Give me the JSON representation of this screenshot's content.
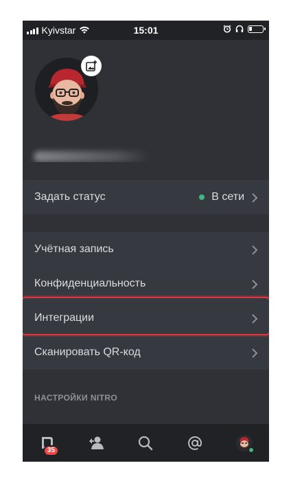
{
  "status_bar": {
    "carrier": "Kyivstar",
    "time": "15:01"
  },
  "profile": {
    "username_blurred": true
  },
  "rows": {
    "set_status": {
      "label": "Задать статус",
      "value": "В сети",
      "dot_color": "#43b581"
    },
    "account": {
      "label": "Учётная запись"
    },
    "privacy": {
      "label": "Конфиденциальность"
    },
    "integrations": {
      "label": "Интеграции",
      "highlighted": true
    },
    "scan_qr": {
      "label": "Сканировать QR-код"
    }
  },
  "sections": {
    "nitro_header": "НАСТРОЙКИ NITRO"
  },
  "tabbar": {
    "tabs": [
      "servers-tab",
      "friends-tab",
      "search-tab",
      "mentions-tab",
      "profile-tab"
    ],
    "notification_badge": "35"
  },
  "colors": {
    "accent_green": "#43b581",
    "badge_red": "#f04747",
    "highlight_red": "#d9373f"
  }
}
